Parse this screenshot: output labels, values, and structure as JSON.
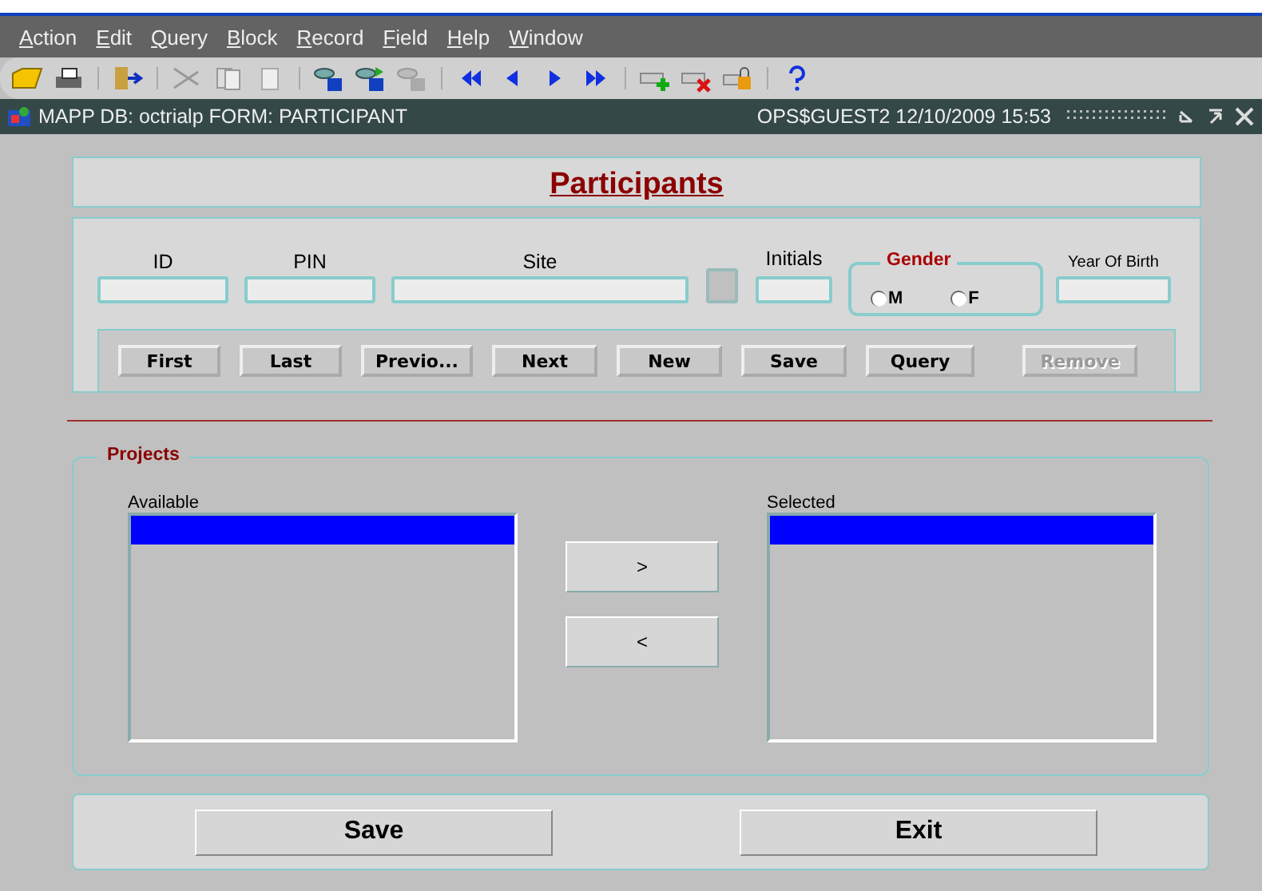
{
  "menu": [
    "Action",
    "Edit",
    "Query",
    "Block",
    "Record",
    "Field",
    "Help",
    "Window"
  ],
  "title_bar": {
    "left": "MAPP DB: octrialp  FORM: PARTICIPANT",
    "right": "OPS$GUEST2  12/10/2009 15:53"
  },
  "form_title": "Participants",
  "fields": [
    {
      "label": "ID",
      "kind": "text"
    },
    {
      "label": "PIN",
      "kind": "text"
    },
    {
      "label": "Site",
      "kind": "text"
    },
    {
      "kind": "lov"
    },
    {
      "label": "Initials",
      "kind": "text"
    }
  ],
  "gender": {
    "label": "Gender",
    "options": [
      {
        "label": "M",
        "selected": false
      },
      {
        "label": "F",
        "selected": false
      }
    ]
  },
  "year_of_birth": {
    "label": "Year Of Birth"
  },
  "nav_buttons": [
    {
      "label": "First",
      "disabled": false
    },
    {
      "label": "Last",
      "disabled": false
    },
    {
      "label": "Previo...",
      "disabled": false
    },
    {
      "label": "Next",
      "disabled": false
    },
    {
      "label": "New",
      "disabled": false
    },
    {
      "label": "Save",
      "disabled": false
    },
    {
      "label": "Query",
      "disabled": false
    },
    {
      "label": "Remove",
      "disabled": true
    }
  ],
  "projects": {
    "label": "Projects",
    "available": {
      "label": "Available",
      "rows": [
        {
          "selected": true
        }
      ]
    },
    "selected": {
      "label": "Selected",
      "rows": [
        {
          "selected": true
        }
      ]
    },
    "move_buttons": [
      ">",
      "<"
    ]
  },
  "bottom_buttons": [
    "Save",
    "Exit"
  ]
}
